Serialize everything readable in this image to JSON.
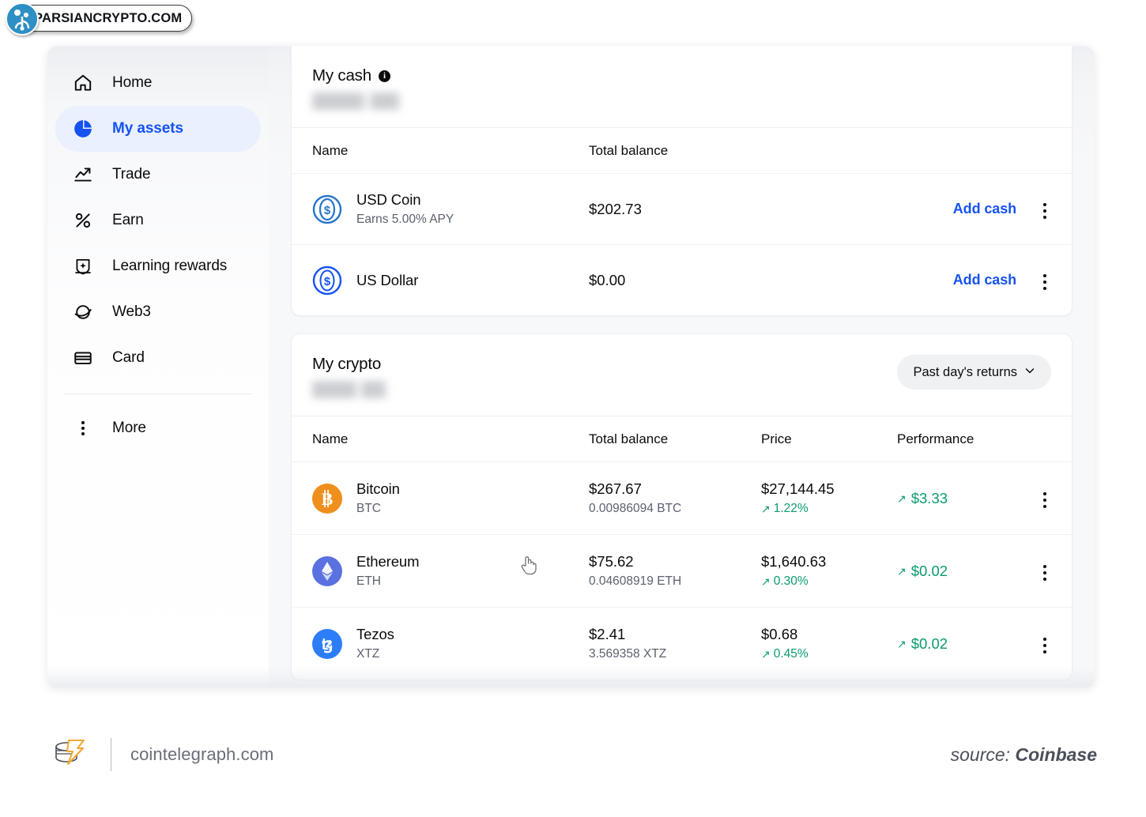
{
  "watermark": {
    "text": "PARSIANCRYPTO.COM",
    "logo_icon": "parsian-logo-icon"
  },
  "sidebar": {
    "items": [
      {
        "label": "Home",
        "icon": "home-icon",
        "active": false
      },
      {
        "label": "My assets",
        "icon": "pie-chart-icon",
        "active": true
      },
      {
        "label": "Trade",
        "icon": "trending-up-icon",
        "active": false
      },
      {
        "label": "Earn",
        "icon": "percent-icon",
        "active": false
      },
      {
        "label": "Learning rewards",
        "icon": "graduation-badge-icon",
        "active": false
      },
      {
        "label": "Web3",
        "icon": "planet-icon",
        "active": false
      },
      {
        "label": "Card",
        "icon": "credit-card-icon",
        "active": false
      }
    ],
    "more": {
      "label": "More",
      "icon": "kebab-icon"
    }
  },
  "cash_section": {
    "title": "My cash",
    "info_icon": "info-icon",
    "balance_redacted": true,
    "columns": {
      "name": "Name",
      "total_balance": "Total balance"
    },
    "rows": [
      {
        "name": "USD Coin",
        "sub": "Earns 5.00% APY",
        "total_balance": "$202.73",
        "action": "Add cash",
        "icon": "usd-coin-icon",
        "color": "#2775ca"
      },
      {
        "name": "US Dollar",
        "sub": "",
        "total_balance": "$0.00",
        "action": "Add cash",
        "icon": "us-dollar-icon",
        "color": "#1652f0"
      }
    ]
  },
  "crypto_section": {
    "title": "My crypto",
    "balance_redacted": true,
    "returns_filter": {
      "label": "Past day's returns",
      "chevron": "chevron-down-icon"
    },
    "columns": {
      "name": "Name",
      "total_balance": "Total balance",
      "price": "Price",
      "performance": "Performance"
    },
    "rows": [
      {
        "name": "Bitcoin",
        "symbol": "BTC",
        "total_balance": "$267.67",
        "amount": "0.00986094 BTC",
        "price": "$27,144.45",
        "change_pct": "1.22%",
        "performance": "$3.33",
        "trend": "up",
        "icon": "bitcoin-icon",
        "color": "#ef8f1c"
      },
      {
        "name": "Ethereum",
        "symbol": "ETH",
        "total_balance": "$75.62",
        "amount": "0.04608919 ETH",
        "price": "$1,640.63",
        "change_pct": "0.30%",
        "performance": "$0.02",
        "trend": "up",
        "icon": "ethereum-icon",
        "color": "#5a72e0"
      },
      {
        "name": "Tezos",
        "symbol": "XTZ",
        "total_balance": "$2.41",
        "amount": "3.569358 XTZ",
        "price": "$0.68",
        "change_pct": "0.45%",
        "performance": "$0.02",
        "trend": "up",
        "icon": "tezos-icon",
        "color": "#2c7df7"
      }
    ]
  },
  "footer": {
    "site": "cointelegraph.com",
    "logo_icon": "cointelegraph-logo-icon",
    "source_prefix": "source: ",
    "source_name": "Coinbase"
  },
  "colors": {
    "accent_blue": "#1652f0",
    "positive_green": "#0a9b6e",
    "text_primary": "#0a0b0d",
    "text_secondary": "#5b616e"
  },
  "cursor": {
    "icon": "pointing-hand-cursor"
  }
}
